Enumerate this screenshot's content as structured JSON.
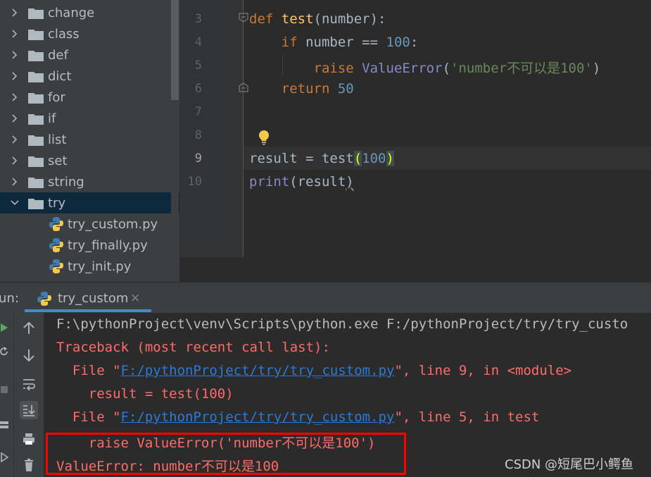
{
  "project_tree": {
    "folders": [
      {
        "label": "change",
        "expanded": false
      },
      {
        "label": "class",
        "expanded": false
      },
      {
        "label": "def",
        "expanded": false
      },
      {
        "label": "dict",
        "expanded": false
      },
      {
        "label": "for",
        "expanded": false
      },
      {
        "label": "if",
        "expanded": false
      },
      {
        "label": "list",
        "expanded": false
      },
      {
        "label": "set",
        "expanded": false
      },
      {
        "label": "string",
        "expanded": false
      },
      {
        "label": "try",
        "expanded": true,
        "selected": true
      }
    ],
    "files": [
      "try_custom.py",
      "try_finally.py",
      "try_init.py"
    ]
  },
  "editor": {
    "line_numbers": [
      "3",
      "4",
      "5",
      "6",
      "7",
      "8",
      "9",
      "10"
    ],
    "current_line": "9",
    "lines": {
      "l3": {
        "kw": "def",
        "fn": "test",
        "rest": "(number):"
      },
      "l4": {
        "kw": "if",
        "mid": " number == ",
        "num": "100",
        "end": ":"
      },
      "l5": {
        "kw": "raise",
        "builtin": "ValueError",
        "open": "(",
        "str": "'number不可以是100'",
        "close": ")"
      },
      "l6": {
        "kw": "return",
        "num": "50"
      },
      "l9": {
        "pre": "result = test",
        "open": "(",
        "num": "100",
        "close": ")"
      },
      "l10": {
        "builtin": "print",
        "mid": "(result",
        "close": ")"
      }
    }
  },
  "run_panel": {
    "label": "un:",
    "tab_label": "try_custom",
    "close_glyph": "×"
  },
  "console": {
    "command": "F:\\pythonProject\\venv\\Scripts\\python.exe F:/pythonProject/try/try_custo",
    "traceback_header": "Traceback (most recent call last):",
    "frame1": {
      "prefix": "  File \"",
      "path": "F:/pythonProject/try/try_custom.py",
      "suffix": "\", line 9, in <module>"
    },
    "frame1_code": "    result = test(100)",
    "frame2": {
      "prefix": "  File \"",
      "path": "F:/pythonProject/try/try_custom.py",
      "suffix": "\", line 5, in test"
    },
    "frame2_code": "    raise ValueError('number不可以是100')",
    "error": "ValueError: number不可以是100"
  },
  "watermark": "CSDN @短尾巴小鳄鱼",
  "colors": {
    "keyword": "#cc7832",
    "function": "#ffc66d",
    "number": "#6897bb",
    "string": "#6a8759",
    "error_text": "#ff6b68",
    "link": "#287bde",
    "highlight_box": "#ff0000",
    "selection": "#0d293e"
  }
}
